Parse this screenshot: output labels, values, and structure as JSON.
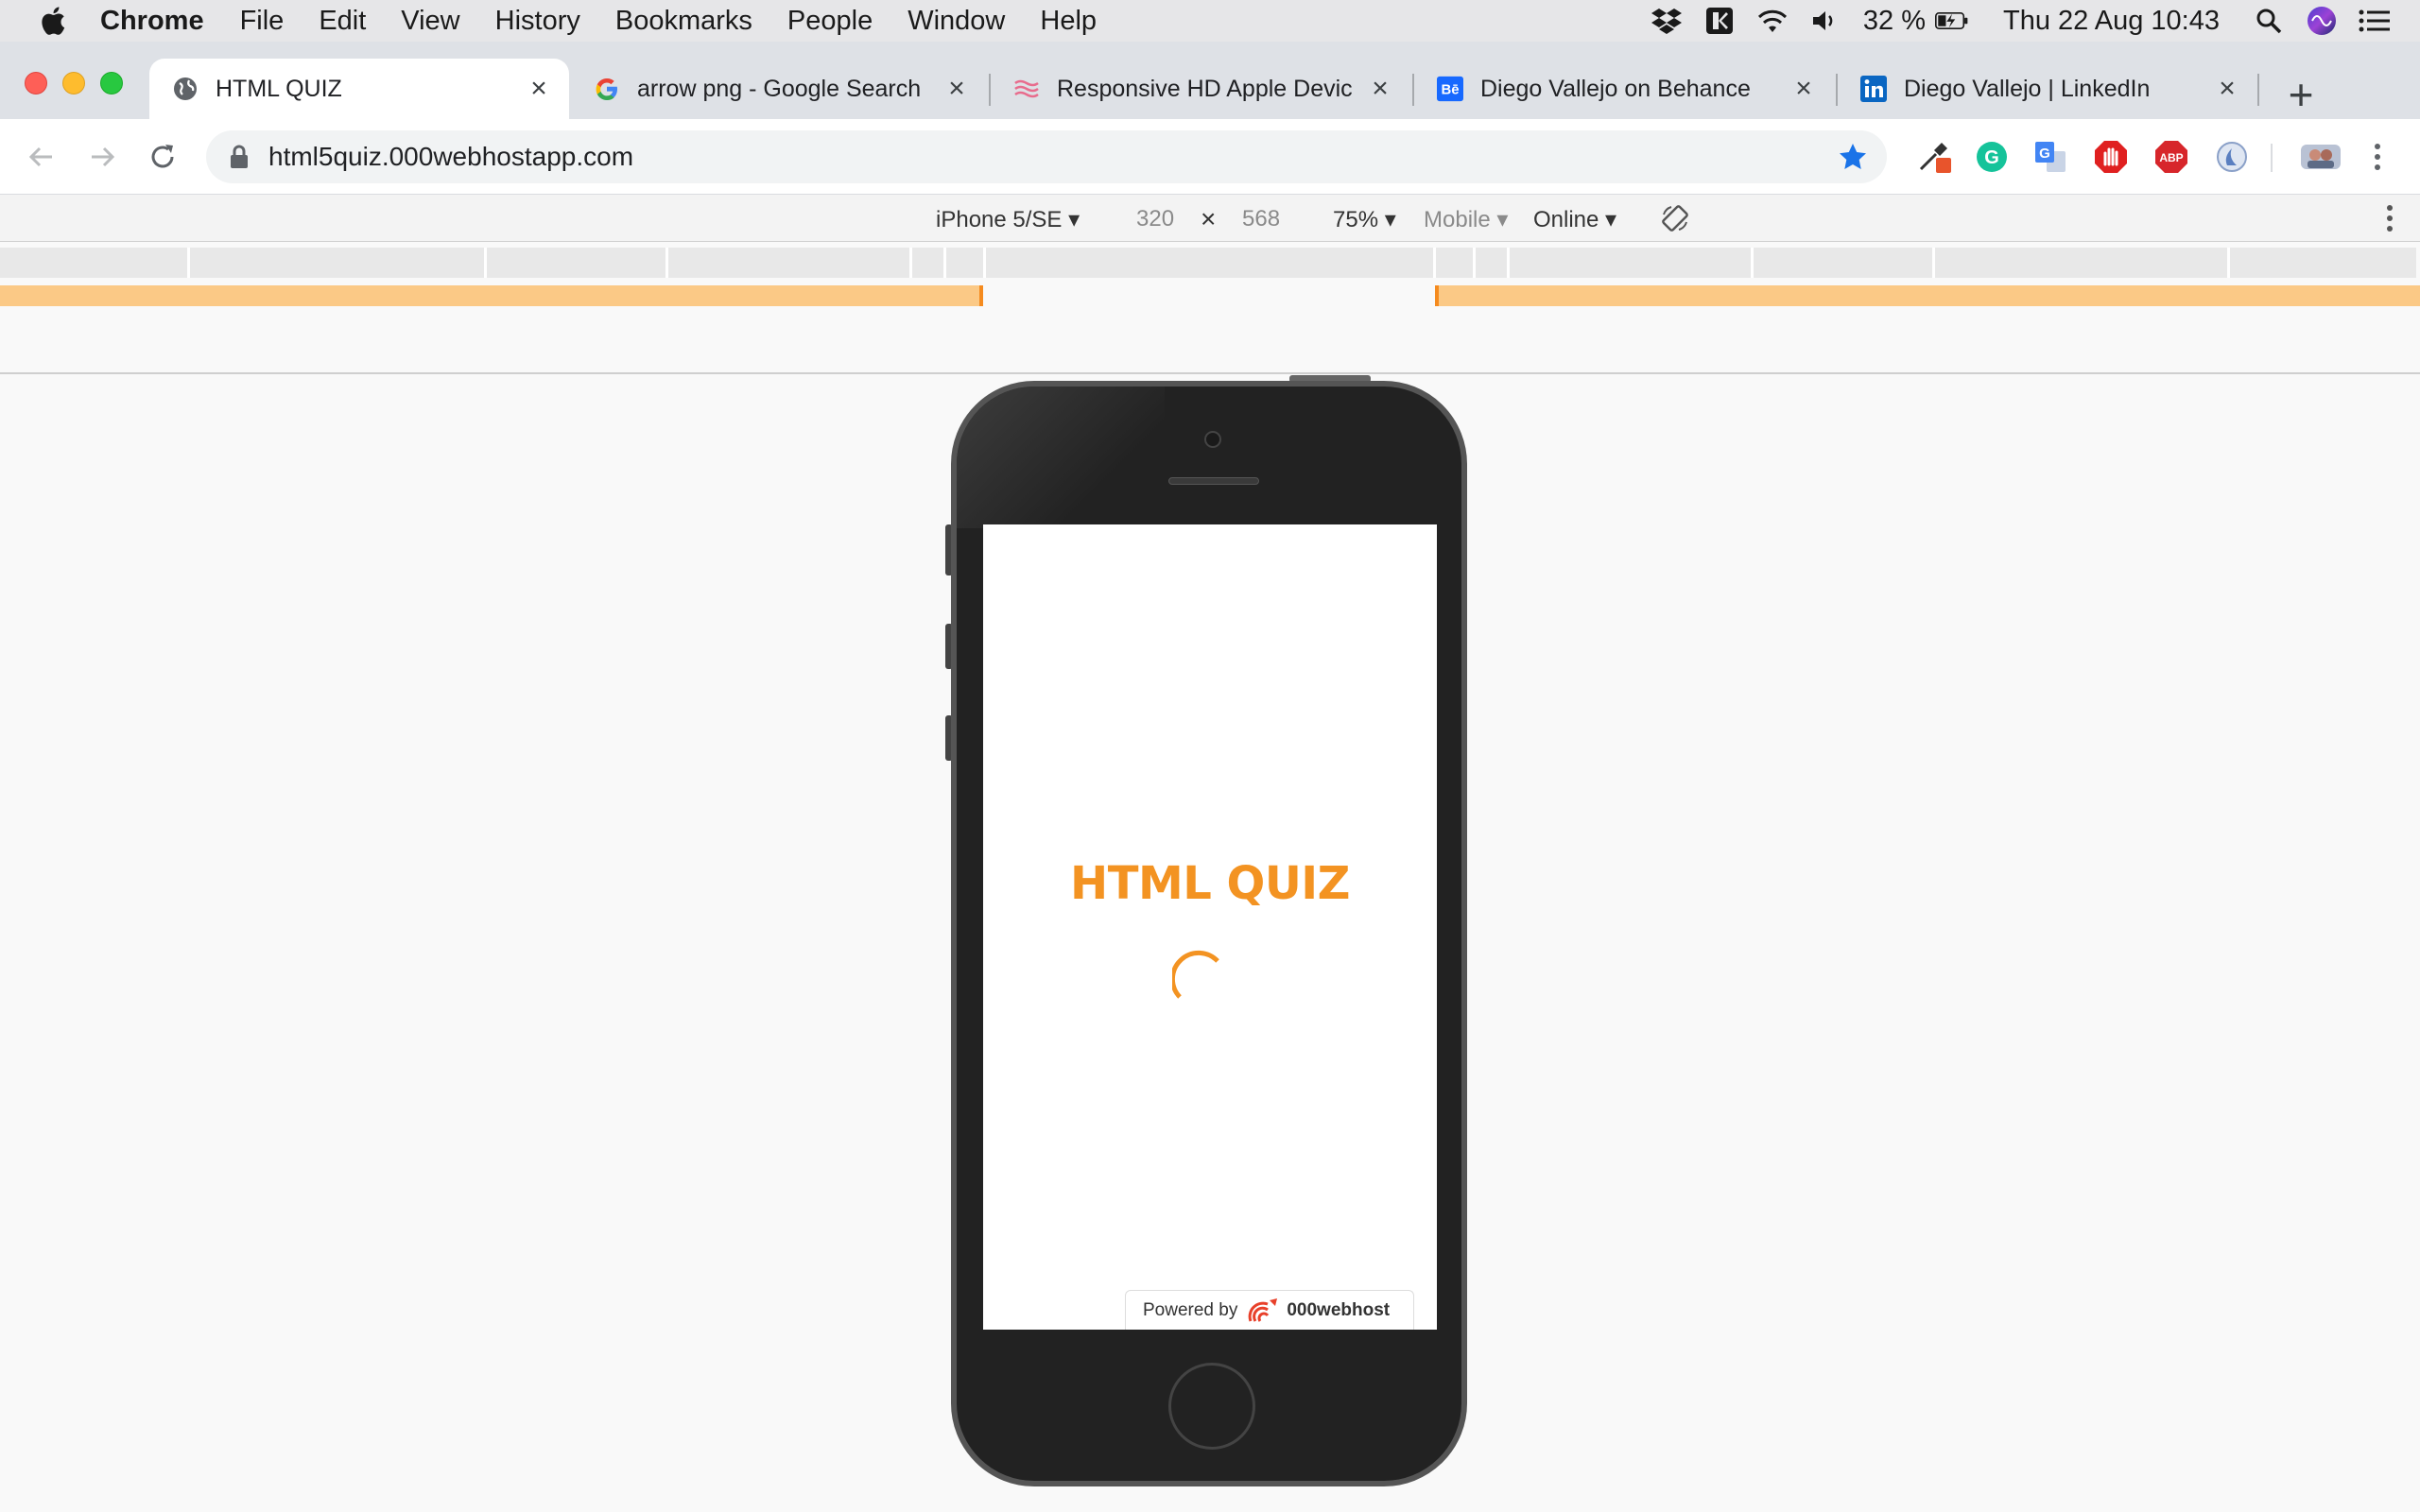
{
  "menubar": {
    "app": "Chrome",
    "items": [
      "File",
      "Edit",
      "View",
      "History",
      "Bookmarks",
      "People",
      "Window",
      "Help"
    ],
    "battery": "32 %",
    "datetime": "Thu 22 Aug  10:43"
  },
  "tabs": [
    {
      "title": "HTML QUIZ",
      "favicon": "globe-icon",
      "active": true
    },
    {
      "title": "arrow png - Google Search",
      "favicon": "google-icon",
      "active": false
    },
    {
      "title": "Responsive HD Apple Devic",
      "favicon": "waves-icon",
      "active": false
    },
    {
      "title": "Diego Vallejo on Behance",
      "favicon": "behance-icon",
      "active": false
    },
    {
      "title": "Diego Vallejo | LinkedIn",
      "favicon": "linkedin-icon",
      "active": false
    }
  ],
  "toolbar": {
    "url": "html5quiz.000webhostapp.com"
  },
  "devtools": {
    "device": "iPhone 5/SE ▾",
    "width": "320",
    "times": "×",
    "height": "568",
    "zoom": "75% ▾",
    "mode": "Mobile ▾",
    "network": "Online ▾"
  },
  "page": {
    "title": "HTML QUIZ",
    "powered_label": "Powered by",
    "powered_brand": "000webhost"
  },
  "colors": {
    "accent": "#f39322",
    "mq_orange": "#fbc986"
  }
}
